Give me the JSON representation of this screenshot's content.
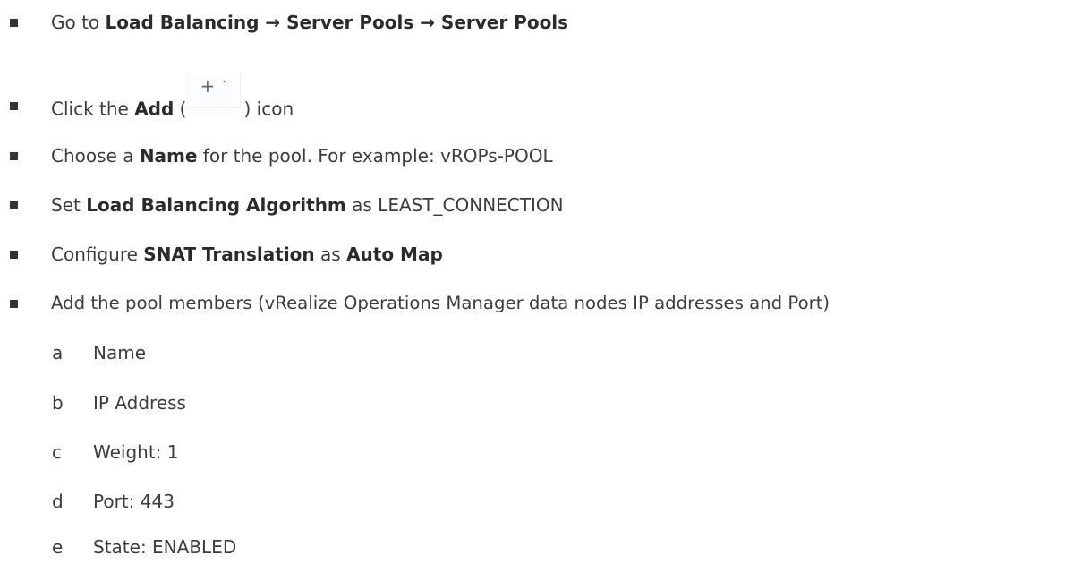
{
  "steps": [
    {
      "parts": [
        {
          "t": "Go to ",
          "b": false
        },
        {
          "t": "Load Balancing → Server Pools → Server Pools",
          "b": true
        }
      ]
    },
    {
      "parts_before": [
        {
          "t": "Click the ",
          "b": false
        },
        {
          "t": "Add",
          "b": true
        },
        {
          "t": " (",
          "b": false
        }
      ],
      "icon": {
        "plus": "+",
        "chevron": "⌄",
        "name": "add-icon"
      },
      "parts_after": [
        {
          "t": ") icon",
          "b": false
        }
      ]
    },
    {
      "parts": [
        {
          "t": "Choose a ",
          "b": false
        },
        {
          "t": "Name",
          "b": true
        },
        {
          "t": " for the pool. For example: vROPs-POOL",
          "b": false
        }
      ]
    },
    {
      "parts": [
        {
          "t": "Set ",
          "b": false
        },
        {
          "t": "Load Balancing Algorithm",
          "b": true
        },
        {
          "t": " as LEAST_CONNECTION",
          "b": false
        }
      ]
    },
    {
      "parts": [
        {
          "t": "Configure ",
          "b": false
        },
        {
          "t": "SNAT Translation",
          "b": true
        },
        {
          "t": " as ",
          "b": false
        },
        {
          "t": "Auto Map",
          "b": true
        }
      ]
    },
    {
      "parts": [
        {
          "t": "Add the pool members (vRealize Operations Manager data nodes IP addresses and Port)",
          "b": false
        }
      ]
    }
  ],
  "substeps": [
    {
      "letter": "a",
      "text": "Name"
    },
    {
      "letter": "b",
      "text": "IP Address"
    },
    {
      "letter": "c",
      "text": "Weight: 1"
    },
    {
      "letter": "d",
      "text": "Port: 443"
    },
    {
      "letter": "e",
      "text": "State: ENABLED"
    }
  ]
}
